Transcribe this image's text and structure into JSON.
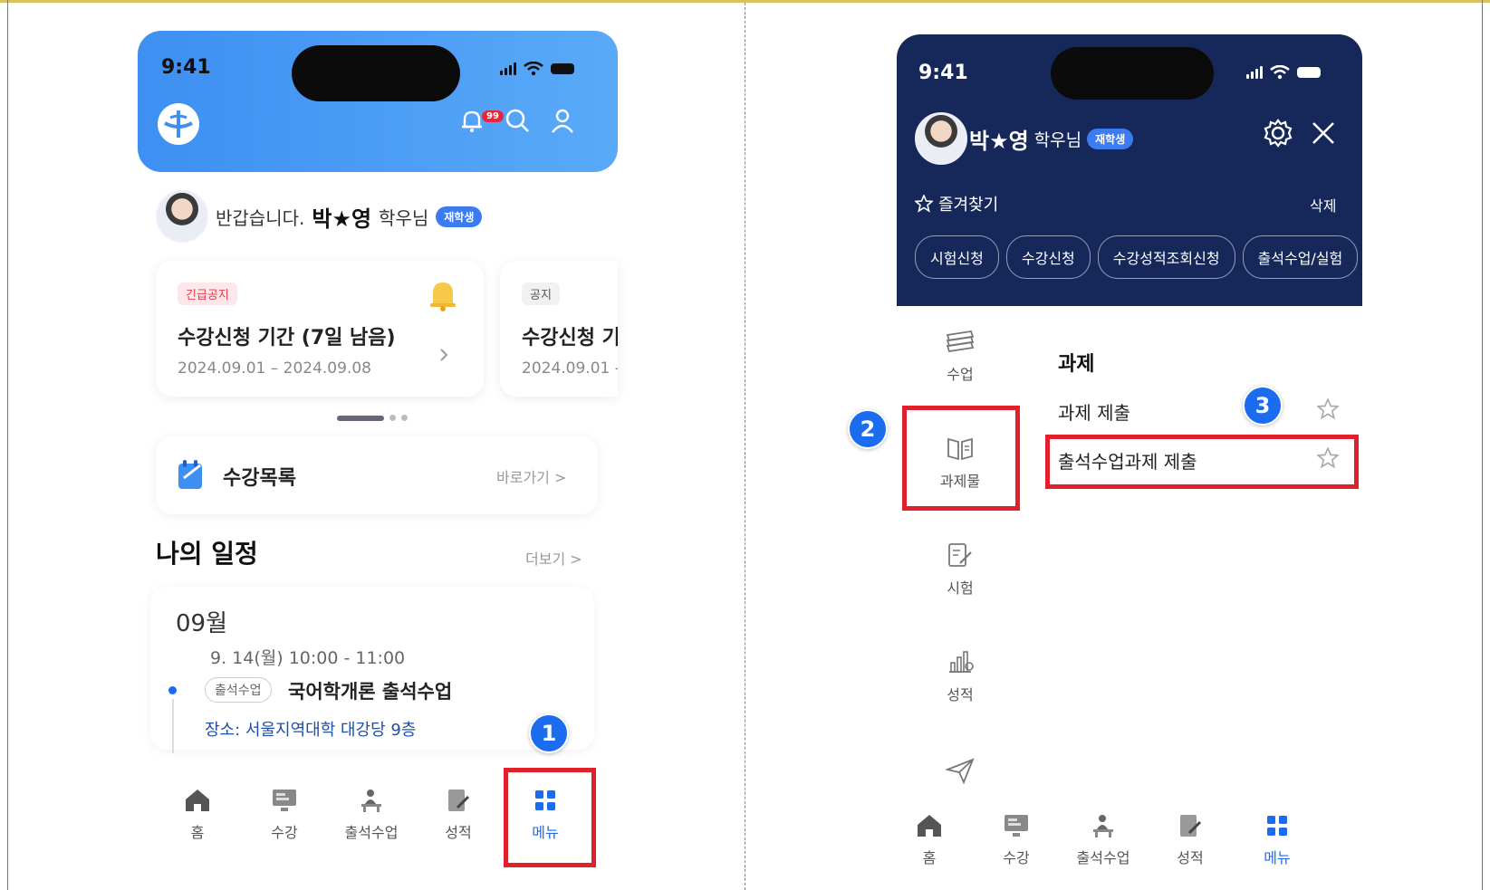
{
  "left": {
    "status": {
      "time": "9:41"
    },
    "notification_count": "99",
    "greeting": {
      "prefix": "반갑습니다.",
      "name": "박★영",
      "suffix": "학우님",
      "badge": "재학생"
    },
    "notices": [
      {
        "tag": "긴급공지",
        "title": "수강신청 기간 (7일 남음)",
        "date": "2024.09.01 – 2024.09.08"
      },
      {
        "tag": "공지",
        "title": "수강신청 기",
        "date": "2024.09.01 -"
      }
    ],
    "course_list": {
      "title": "수강목록",
      "link": "바로가기 >"
    },
    "schedule": {
      "title": "나의 일정",
      "more": "더보기 >",
      "month": "09월",
      "time": "9. 14(월) 10:00 - 11:00",
      "tag": "출석수업",
      "event": "국어학개론 출석수업",
      "place": "장소: 서울지역대학 대강당 9층"
    },
    "tabs": [
      {
        "label": "홈",
        "icon": "home-icon"
      },
      {
        "label": "수강",
        "icon": "monitor-icon"
      },
      {
        "label": "출석수업",
        "icon": "desk-icon"
      },
      {
        "label": "성적",
        "icon": "edit-doc-icon"
      },
      {
        "label": "메뉴",
        "icon": "grid-icon"
      }
    ],
    "marker": "1"
  },
  "right": {
    "status": {
      "time": "9:41"
    },
    "user": {
      "name": "박★영",
      "suffix": "학우님",
      "badge": "재학생"
    },
    "favorites": {
      "label": "즐겨찾기",
      "delete": "삭제",
      "chips": [
        "시험신청",
        "수강신청",
        "수강성적조회신청",
        "출석수업/실험"
      ]
    },
    "side_menu": [
      {
        "label": "수업",
        "icon": "books-icon"
      },
      {
        "label": "과제물",
        "icon": "book-open-icon"
      },
      {
        "label": "시험",
        "icon": "exam-icon"
      },
      {
        "label": "성적",
        "icon": "chart-icon"
      },
      {
        "label": "",
        "icon": "send-icon"
      }
    ],
    "section": {
      "title": "과제",
      "items": [
        "과제 제출",
        "출석수업과제 제출"
      ]
    },
    "tabs": [
      {
        "label": "홈",
        "icon": "home-icon"
      },
      {
        "label": "수강",
        "icon": "monitor-icon"
      },
      {
        "label": "출석수업",
        "icon": "desk-icon"
      },
      {
        "label": "성적",
        "icon": "edit-doc-icon"
      },
      {
        "label": "메뉴",
        "icon": "grid-icon"
      }
    ],
    "markers": [
      "2",
      "3"
    ]
  },
  "colors": {
    "accent_blue": "#3d8ff2",
    "navy": "#16285a",
    "highlight_red": "#e2202c",
    "marker_blue": "#1c6cf0"
  }
}
